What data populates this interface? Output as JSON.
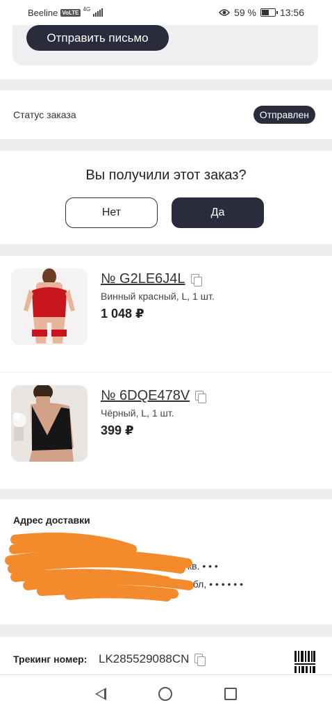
{
  "status_bar": {
    "carrier": "Beeline",
    "volte": "VoLTE",
    "network": "4G",
    "battery": "59 %",
    "battery_level": 0.59,
    "time": "13:56"
  },
  "actions": {
    "send_letter": "Отправить письмо"
  },
  "order_status": {
    "label": "Статус заказа",
    "value": "Отправлен"
  },
  "received_question": {
    "title": "Вы получили этот заказ?",
    "no_label": "Нет",
    "yes_label": "Да"
  },
  "products": [
    {
      "sku": "№ G2LE6J4L",
      "variant": "Винный красный, L, 1 шт.",
      "price": "1 048 ₽",
      "color": "#c8141c"
    },
    {
      "sku": "№ 6DQE478V",
      "variant": "Чёрный, L, 1 шт.",
      "price": "399 ₽",
      "color": "#161618"
    }
  ],
  "address": {
    "title": "Адрес доставки",
    "line2_tail": "кв.  •  •  •",
    "line3_tail": "обл,  •  •  •  •  •  •",
    "redaction_color": "#f38a2c"
  },
  "tracking": {
    "label": "Трекинг номер:",
    "number": "LK285529088CN"
  }
}
